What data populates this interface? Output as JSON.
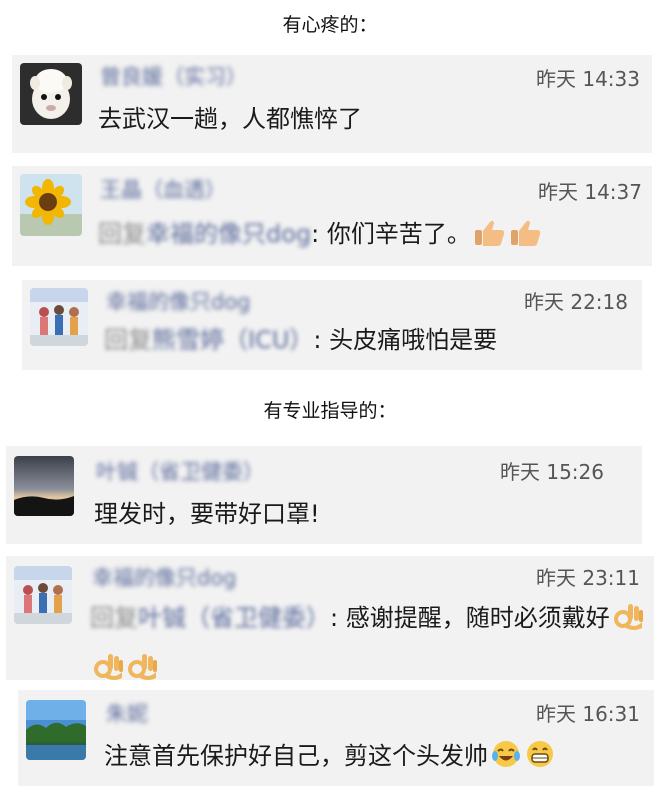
{
  "sections": {
    "first_title": "有心疼的：",
    "second_title": "有专业指导的："
  },
  "comments": [
    {
      "name": "曾良媛（实习）",
      "time": "昨天 14:33",
      "text": "去武汉一趟，人都憔悴了"
    },
    {
      "name": "王晶（血透）",
      "time": "昨天 14:37",
      "reply_prefix": "回复",
      "reply_target": "幸福的像只dog",
      "text": ": 你们辛苦了。",
      "emoji": [
        "thumbs-up-icon",
        "thumbs-up-icon"
      ]
    },
    {
      "name": "幸福的像只dog",
      "time": "昨天 22:18",
      "reply_prefix": "回复",
      "reply_target": "熊雪婷（ICU）",
      "text": ": 头皮痛哦怕是要"
    },
    {
      "name": "叶铖（省卫健委）",
      "time": "昨天 15:26",
      "text": "理发时，要带好口罩!"
    },
    {
      "name": "幸福的像只dog",
      "time": "昨天 23:11",
      "reply_prefix": "回复",
      "reply_target": "叶铖（省卫健委）",
      "text": ": 感谢提醒，随时必须戴好",
      "emoji": [
        "ok-hand-icon",
        "ok-hand-icon",
        "ok-hand-icon"
      ]
    },
    {
      "name": "朱妮",
      "time": "昨天 16:31",
      "text": "注意首先保护好自己，剪这个头发帅",
      "emoji": [
        "tears-of-joy-icon",
        "grinning-icon"
      ]
    }
  ]
}
